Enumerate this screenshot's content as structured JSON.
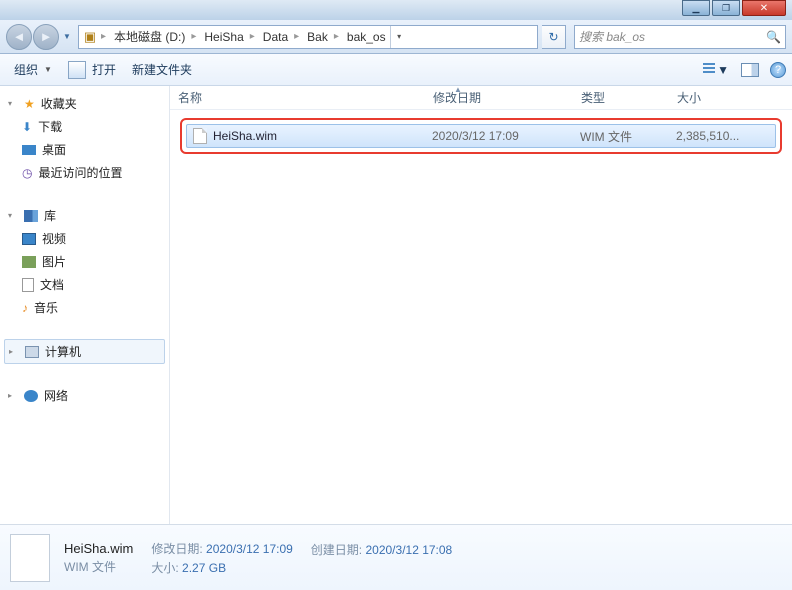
{
  "titlebar": {},
  "address": {
    "segments": [
      "本地磁盘 (D:)",
      "HeiSha",
      "Data",
      "Bak",
      "bak_os"
    ],
    "search_placeholder": "搜索 bak_os"
  },
  "toolbar": {
    "organize": "组织",
    "open": "打开",
    "new_folder": "新建文件夹"
  },
  "sidebar": {
    "favorites": "收藏夹",
    "downloads": "下载",
    "desktop": "桌面",
    "recent": "最近访问的位置",
    "libraries": "库",
    "videos": "视频",
    "pictures": "图片",
    "documents": "文档",
    "music": "音乐",
    "computer": "计算机",
    "network": "网络"
  },
  "columns": {
    "name": "名称",
    "date": "修改日期",
    "type": "类型",
    "size": "大小"
  },
  "file": {
    "name": "HeiSha.wim",
    "date": "2020/3/12 17:09",
    "type": "WIM 文件",
    "size": "2,385,510..."
  },
  "details": {
    "name": "HeiSha.wim",
    "type": "WIM 文件",
    "mod_label": "修改日期:",
    "mod_val": "2020/3/12 17:09",
    "size_label": "大小:",
    "size_val": "2.27 GB",
    "create_label": "创建日期:",
    "create_val": "2020/3/12 17:08"
  }
}
